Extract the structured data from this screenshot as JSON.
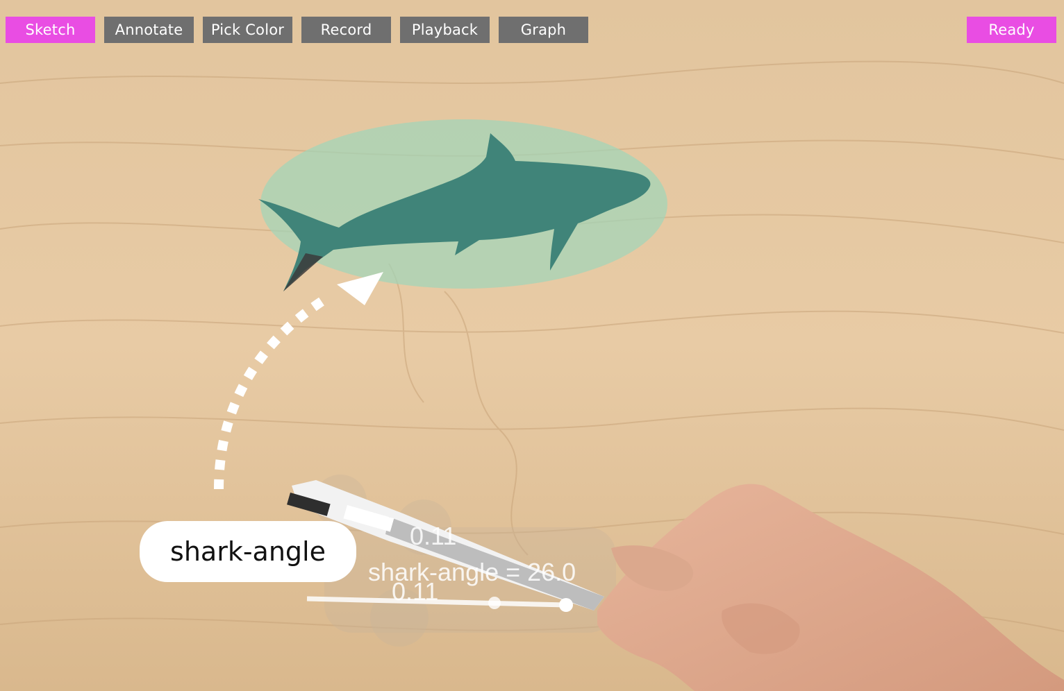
{
  "toolbar": {
    "buttons": [
      {
        "label": "Sketch",
        "active": true
      },
      {
        "label": "Annotate",
        "active": false
      },
      {
        "label": "Pick Color",
        "active": false
      },
      {
        "label": "Record",
        "active": false
      },
      {
        "label": "Playback",
        "active": false
      },
      {
        "label": "Graph",
        "active": false
      }
    ],
    "status_label": "Ready"
  },
  "annotation": {
    "variable_label": "shark-angle"
  },
  "slider_overlay": {
    "top_value": "0.11",
    "readout": "shark-angle = 26.0",
    "bottom_value": "0.11"
  },
  "colors": {
    "active_button": "#e94de3",
    "inactive_button": "#6f6f6f",
    "shark": "#3a7f76",
    "ellipse": "#9fd6b9"
  }
}
